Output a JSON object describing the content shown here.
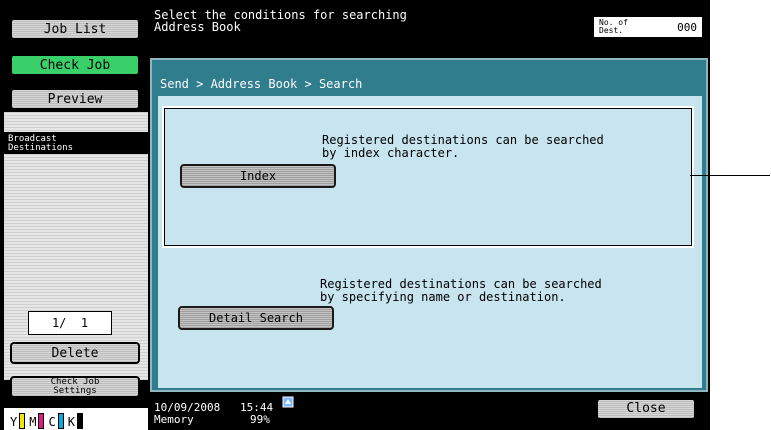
{
  "left_panel": {
    "job_list": "Job List",
    "check_job": "Check Job",
    "preview": "Preview",
    "broadcast_destinations": "Broadcast\nDestinations",
    "pager": "1/  1",
    "delete": "Delete",
    "check_job_settings": "Check Job\nSettings",
    "toner": [
      "Y",
      "M",
      "C",
      "K"
    ],
    "toner_colors": [
      "#f2e600",
      "#e0198c",
      "#00aee0",
      "#000000"
    ]
  },
  "header": {
    "message": "Select the conditions for searching\nAddress Book",
    "dest_label": "No. of\nDest.",
    "dest_count": "000"
  },
  "main": {
    "breadcrumb": "Send > Address Book > Search",
    "index": {
      "description": "Registered destinations can be searched\nby index character.",
      "button": "Index"
    },
    "detail": {
      "description": "Registered destinations can be searched\nby specifying name or destination.",
      "button": "Detail Search"
    }
  },
  "status": {
    "date": "10/09/2008",
    "time": "15:44",
    "memory_label": "Memory",
    "memory_value": "99%",
    "close": "Close"
  }
}
